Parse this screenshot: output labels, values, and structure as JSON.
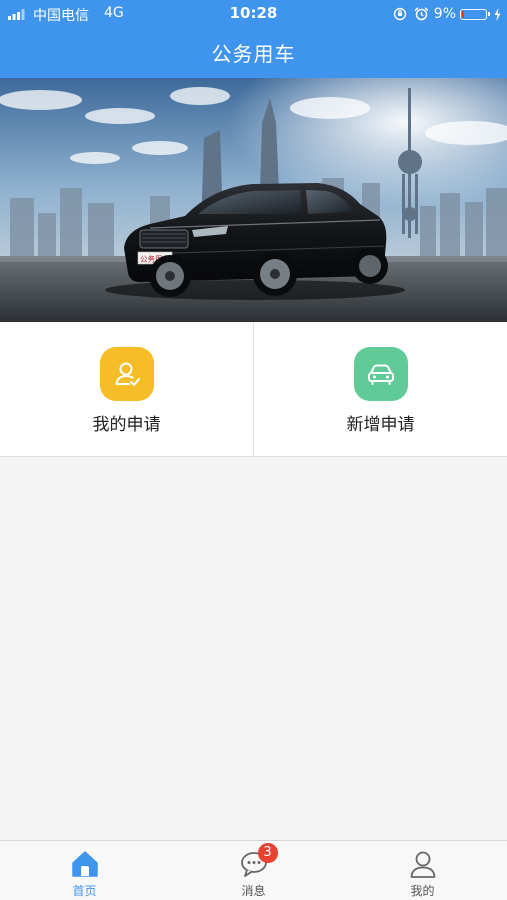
{
  "status_bar": {
    "carrier": "中国电信",
    "network": "4G",
    "time": "10:28",
    "battery_percent": "9%",
    "battery_level": 0.09
  },
  "header": {
    "title": "公务用车",
    "background_color": "#3f94ee"
  },
  "banner": {
    "plate_text": "公务用车"
  },
  "actions": [
    {
      "label": "我的申请",
      "icon": "user-check-icon",
      "color": "#f6bd27"
    },
    {
      "label": "新增申请",
      "icon": "car-icon",
      "color": "#61cb98"
    }
  ],
  "tabbar": {
    "tabs": [
      {
        "label": "首页",
        "icon": "home-icon",
        "active": true
      },
      {
        "label": "消息",
        "icon": "chat-icon",
        "active": false,
        "badge": "3"
      },
      {
        "label": "我的",
        "icon": "person-icon",
        "active": false
      }
    ],
    "active_color": "#3f94ee"
  }
}
